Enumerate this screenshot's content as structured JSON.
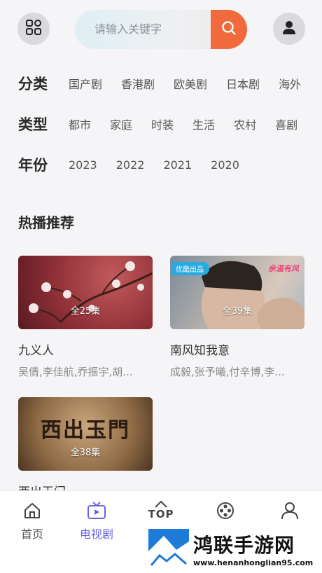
{
  "search": {
    "placeholder": "请输入关键字"
  },
  "filters": [
    {
      "title": "分类",
      "options": [
        "国产剧",
        "香港剧",
        "欧美剧",
        "日本剧",
        "海外"
      ]
    },
    {
      "title": "类型",
      "options": [
        "都市",
        "家庭",
        "时装",
        "生活",
        "农村",
        "喜剧"
      ]
    },
    {
      "title": "年份",
      "options": [
        "2023",
        "2022",
        "2021",
        "2020"
      ]
    }
  ],
  "section": {
    "title": "热播推荐"
  },
  "cards": [
    {
      "title": "九义人",
      "cast": "吴倩,李佳航,乔振宇,胡...",
      "episodes": "全25集"
    },
    {
      "title": "南风知我意",
      "cast": "成毅,张予曦,付辛博,李...",
      "episodes": "全39集",
      "badge": "优酷出品",
      "logo": "余温有风"
    },
    {
      "title": "西出玉门",
      "cast": "",
      "episodes": "全38集",
      "poster_text": "西出玉門"
    }
  ],
  "nav": [
    {
      "label": "首页",
      "icon": "home-icon"
    },
    {
      "label": "电视剧",
      "icon": "tv-icon",
      "active": true
    },
    {
      "label": "TOP",
      "icon": "top-icon"
    },
    {
      "label": "",
      "icon": "film-reel-icon"
    },
    {
      "label": "",
      "icon": "user-icon"
    }
  ],
  "watermark": {
    "title": "鸿联手游网",
    "url": "www.henanhonglian95.com"
  },
  "colors": {
    "accent": "#6b63e8",
    "search_button": "#f06a3c",
    "badge": "#28a9e0"
  }
}
